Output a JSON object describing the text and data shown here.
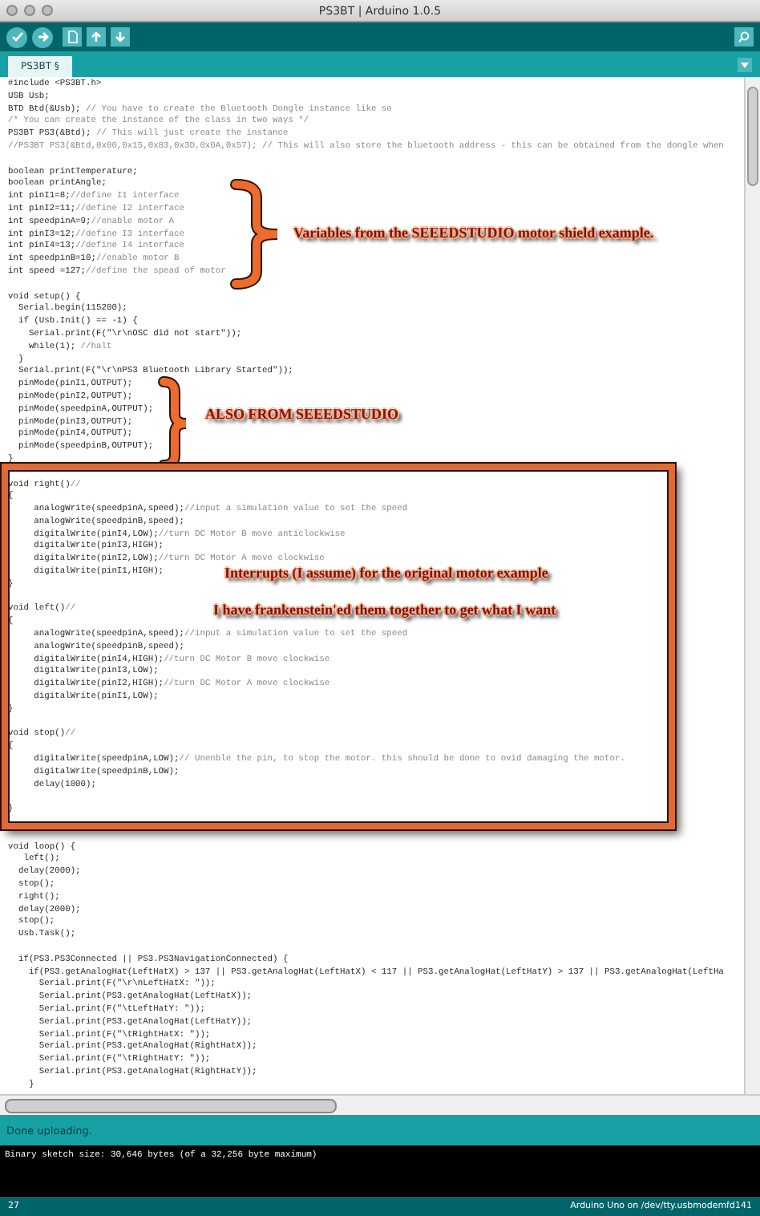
{
  "window": {
    "title": "PS3BT | Arduino 1.0.5"
  },
  "tabs": [
    {
      "label": "PS3BT §",
      "selected": true
    }
  ],
  "editor": {
    "blocks": [
      {
        "lines": [
          {
            "code": "#include <PS3BT.h>"
          },
          {
            "code": "USB Usb;"
          },
          {
            "code": "BTD Btd(&Usb); ",
            "comment": "// You have to create the Bluetooth Dongle instance like so"
          },
          {
            "comment": "/* You can create the instance of the class in two ways */"
          },
          {
            "code": "PS3BT PS3(&Btd); ",
            "comment": "// This will just create the instance"
          },
          {
            "comment": "//PS3BT PS3(&Btd,0x00,0x15,0x83,0x3D,0x0A,0x57); // This will also store the bluetooth address - this can be obtained from the dongle when"
          }
        ]
      },
      {
        "lines": [
          {
            "code": "boolean printTemperature;"
          },
          {
            "code": "boolean printAngle;"
          },
          {
            "code": "int pinI1=8;",
            "comment": "//define I1 interface"
          },
          {
            "code": "int pinI2=11;",
            "comment": "//define I2 interface"
          },
          {
            "code": "int speedpinA=9;",
            "comment": "//enable motor A"
          },
          {
            "code": "int pinI3=12;",
            "comment": "//define I3 interface"
          },
          {
            "code": "int pinI4=13;",
            "comment": "//define I4 interface"
          },
          {
            "code": "int speedpinB=10;",
            "comment": "//enable motor B"
          },
          {
            "code": "int speed =127;",
            "comment": "//define the spead of motor"
          }
        ]
      },
      {
        "lines": [
          {
            "code": "void setup() {"
          },
          {
            "code": "  Serial.begin(115200);"
          },
          {
            "code": "  if (Usb.Init() == -1) {"
          },
          {
            "code": "    Serial.print(F(\"\\r\\nOSC did not start\"));"
          },
          {
            "code": "    while(1); ",
            "comment": "//halt"
          },
          {
            "code": "  }"
          },
          {
            "code": "  Serial.print(F(\"\\r\\nPS3 Bluetooth Library Started\"));"
          },
          {
            "code": "  pinMode(pinI1,OUTPUT);"
          },
          {
            "code": "  pinMode(pinI2,OUTPUT);"
          },
          {
            "code": "  pinMode(speedpinA,OUTPUT);"
          },
          {
            "code": "  pinMode(pinI3,OUTPUT);"
          },
          {
            "code": "  pinMode(pinI4,OUTPUT);"
          },
          {
            "code": "  pinMode(speedpinB,OUTPUT);"
          },
          {
            "code": "}"
          }
        ]
      },
      {
        "lines": [
          {
            "code": "void right()",
            "comment": "//"
          },
          {
            "code": "{"
          },
          {
            "code": "     analogWrite(speedpinA,speed);",
            "comment": "//input a simulation value to set the speed"
          },
          {
            "code": "     analogWrite(speedpinB,speed);"
          },
          {
            "code": "     digitalWrite(pinI4,LOW);",
            "comment": "//turn DC Motor B move anticlockwise"
          },
          {
            "code": "     digitalWrite(pinI3,HIGH);"
          },
          {
            "code": "     digitalWrite(pinI2,LOW);",
            "comment": "//turn DC Motor A move clockwise"
          },
          {
            "code": "     digitalWrite(pinI1,HIGH);"
          },
          {
            "code": "}"
          }
        ]
      },
      {
        "lines": [
          {
            "code": "void left()",
            "comment": "//"
          },
          {
            "code": "{"
          },
          {
            "code": "     analogWrite(speedpinA,speed);",
            "comment": "//input a simulation value to set the speed"
          },
          {
            "code": "     analogWrite(speedpinB,speed);"
          },
          {
            "code": "     digitalWrite(pinI4,HIGH);",
            "comment": "//turn DC Motor B move clockwise"
          },
          {
            "code": "     digitalWrite(pinI3,LOW);"
          },
          {
            "code": "     digitalWrite(pinI2,HIGH);",
            "comment": "//turn DC Motor A move clockwise"
          },
          {
            "code": "     digitalWrite(pinI1,LOW);"
          },
          {
            "code": "}"
          }
        ]
      },
      {
        "lines": [
          {
            "code": "void stop()",
            "comment": "//"
          },
          {
            "code": "{"
          },
          {
            "code": "     digitalWrite(speedpinA,LOW);",
            "comment": "// Unenble the pin, to stop the motor. this should be done to ovid damaging the motor."
          },
          {
            "code": "     digitalWrite(speedpinB,LOW);"
          },
          {
            "code": "     delay(1000);"
          }
        ]
      },
      {
        "lines": [
          {
            "code": "}"
          }
        ]
      },
      {
        "lines": [
          {
            "code": "void loop() {"
          },
          {
            "code": "   left();"
          },
          {
            "code": "  delay(2000);"
          },
          {
            "code": "  stop();"
          },
          {
            "code": "  right();"
          },
          {
            "code": "  delay(2000);"
          },
          {
            "code": "  stop();"
          },
          {
            "code": "  Usb.Task();"
          }
        ]
      },
      {
        "lines": [
          {
            "code": "  if(PS3.PS3Connected || PS3.PS3NavigationConnected) {"
          },
          {
            "code": "    if(PS3.getAnalogHat(LeftHatX) > 137 || PS3.getAnalogHat(LeftHatX) < 117 || PS3.getAnalogHat(LeftHatY) > 137 || PS3.getAnalogHat(LeftHa"
          },
          {
            "code": "      Serial.print(F(\"\\r\\nLeftHatX: \"));"
          },
          {
            "code": "      Serial.print(PS3.getAnalogHat(LeftHatX));"
          },
          {
            "code": "      Serial.print(F(\"\\tLeftHatY: \"));"
          },
          {
            "code": "      Serial.print(PS3.getAnalogHat(LeftHatY));"
          },
          {
            "code": "      Serial.print(F(\"\\tRightHatX: \"));"
          },
          {
            "code": "      Serial.print(PS3.getAnalogHat(RightHatX));"
          },
          {
            "code": "      Serial.print(F(\"\\tRightHatY: \"));"
          },
          {
            "code": "      Serial.print(PS3.getAnalogHat(RightHatY));"
          },
          {
            "code": "    }"
          }
        ]
      }
    ]
  },
  "annotations": [
    {
      "kind": "brace",
      "text": "Variables from the SEEEDSTUDIO motor shield example."
    },
    {
      "kind": "brace",
      "text": "ALSO FROM SEEEDSTUDIO"
    },
    {
      "kind": "frame",
      "text": "Interrupts (I assume) for the original motor example"
    },
    {
      "kind": "note",
      "text": "I have frankenstein'ed them together to get what I want"
    }
  ],
  "status": {
    "message": "Done uploading."
  },
  "console": {
    "lines": [
      "Binary sketch size: 30,646 bytes (of a 32,256 byte maximum)"
    ]
  },
  "status_bar": {
    "line": "27",
    "board": "Arduino Uno on /dev/tty.usbmodemfd141"
  }
}
